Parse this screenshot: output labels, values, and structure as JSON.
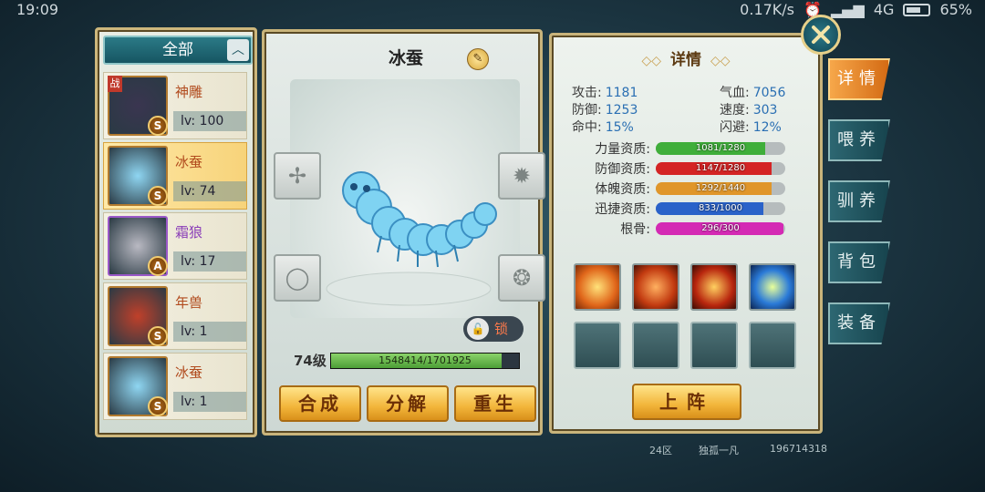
{
  "status_bar": {
    "time": "19:09",
    "net_speed": "0.17K/s",
    "signal": "4G",
    "battery": "65%",
    "battery_level": 0.65
  },
  "filter": {
    "label": "全部"
  },
  "pets": [
    {
      "name": "神雕",
      "level": "lv: 100",
      "grade": "S",
      "battle_tag": "战",
      "selected": false,
      "color": "#b14b1e"
    },
    {
      "name": "冰蚕",
      "level": "lv: 74",
      "grade": "S",
      "battle_tag": "",
      "selected": true,
      "color": "#b14b1e"
    },
    {
      "name": "霜狼",
      "level": "lv: 17",
      "grade": "A",
      "battle_tag": "",
      "selected": false,
      "color": "#8b3fb8"
    },
    {
      "name": "年兽",
      "level": "lv: 1",
      "grade": "S",
      "battle_tag": "",
      "selected": false,
      "color": "#b14b1e"
    },
    {
      "name": "冰蚕",
      "level": "lv: 1",
      "grade": "S",
      "battle_tag": "",
      "selected": false,
      "color": "#b14b1e"
    }
  ],
  "pet_detail": {
    "name": "冰蚕",
    "lock_label": "锁",
    "level_label": "74级",
    "exp_text": "1548414/1701925",
    "exp_fraction": 0.9098
  },
  "actions": {
    "merge": "合成",
    "decompose": "分解",
    "rebirth": "重生",
    "deploy": "上阵"
  },
  "details": {
    "title": "详情",
    "stats": [
      {
        "label": "攻击:",
        "value": "1181"
      },
      {
        "label": "气血:",
        "value": "7056"
      },
      {
        "label": "防御:",
        "value": "1253"
      },
      {
        "label": "速度:",
        "value": "303"
      },
      {
        "label": "命中:",
        "value": "15%"
      },
      {
        "label": "闪避:",
        "value": "12%"
      }
    ],
    "aptitudes": [
      {
        "label": "力量资质:",
        "text": "1081/1280",
        "fraction": 0.8445,
        "color": "#3fae3a"
      },
      {
        "label": "防御资质:",
        "text": "1147/1280",
        "fraction": 0.8961,
        "color": "#d42424"
      },
      {
        "label": "体魄资质:",
        "text": "1292/1440",
        "fraction": 0.8972,
        "color": "#e0962a"
      },
      {
        "label": "迅捷资质:",
        "text": "833/1000",
        "fraction": 0.833,
        "color": "#2a62c9"
      },
      {
        "label": "根骨:",
        "text": "296/300",
        "fraction": 0.9867,
        "color": "#d42ab4"
      }
    ]
  },
  "side_tabs": [
    {
      "label": "详情",
      "active": true
    },
    {
      "label": "喂养",
      "active": false
    },
    {
      "label": "驯养",
      "active": false
    },
    {
      "label": "背包",
      "active": false
    },
    {
      "label": "装备",
      "active": false
    }
  ],
  "footer": {
    "server": "24区",
    "player": "独孤一凡",
    "player_id": "196714318"
  }
}
